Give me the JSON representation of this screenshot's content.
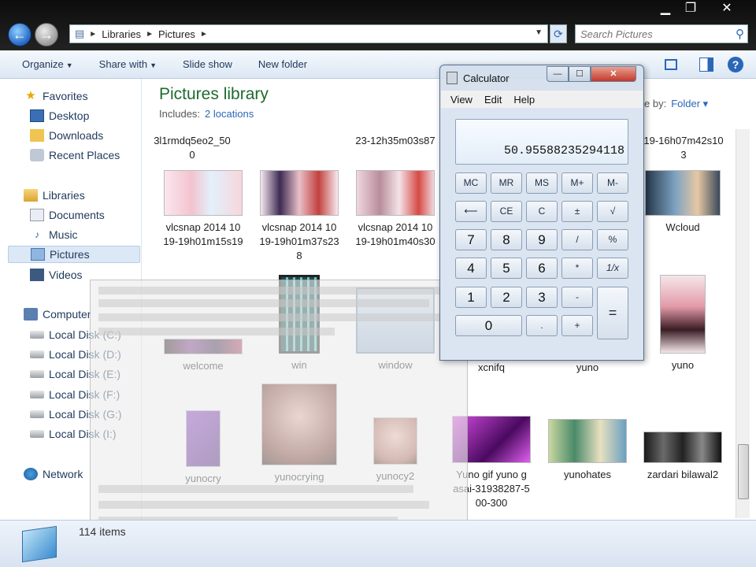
{
  "window": {
    "minimize": "▁",
    "maximize": "❐",
    "close": "✕"
  },
  "address": {
    "segments": [
      "Libraries",
      "Pictures"
    ]
  },
  "search": {
    "placeholder": "Search Pictures"
  },
  "toolbar": {
    "organize": "Organize",
    "share_with": "Share with",
    "slide_show": "Slide show",
    "new_folder": "New folder"
  },
  "sidebar": {
    "favorites": "Favorites",
    "desktop": "Desktop",
    "downloads": "Downloads",
    "recent_places": "Recent Places",
    "libraries": "Libraries",
    "documents": "Documents",
    "music": "Music",
    "pictures": "Pictures",
    "videos": "Videos",
    "computer": "Computer",
    "disks": [
      "Local Disk (C:)",
      "Local Disk (D:)",
      "Local Disk (E:)",
      "Local Disk (F:)",
      "Local Disk (G:)",
      "Local Disk (I:)"
    ],
    "network": "Network"
  },
  "library": {
    "title": "Pictures library",
    "includes_label": "Includes:",
    "locations_link": "2 locations",
    "arrange_label": "e by:",
    "arrange_value": "Folder ▾"
  },
  "top_captions": {
    "c1_line1": "3l1rmdq5eo2_50",
    "c1_line2": "0",
    "c2": "23-12h35m03s87",
    "c3_line1": "19-16h07m42s10",
    "c3_line2": "3"
  },
  "tiles": [
    {
      "name": "vlcsnap-2014-10-19-19h01m15s19",
      "l1": "vlcsnap 2014 10",
      "l2": "19-19h01m15s19",
      "l3": ""
    },
    {
      "name": "vlcsnap-2014-10-19-19h01m37s238",
      "l1": "vlcsnap 2014 10",
      "l2": "19-19h01m37s23",
      "l3": "8"
    },
    {
      "name": "vlcsnap-2014-10-19-19h01m40s30",
      "l1": "vlcsnap 2014 10",
      "l2": "19-19h01m40s30",
      "l3": ""
    },
    {
      "name": "Wcloud",
      "l1": "Wcloud"
    },
    {
      "name": "welcome",
      "l1": "welcome"
    },
    {
      "name": "win",
      "l1": "win"
    },
    {
      "name": "window",
      "l1": "window"
    },
    {
      "name": "xcnifq",
      "l1": "xcnifq"
    },
    {
      "name": "yuno-a",
      "l1": "yuno"
    },
    {
      "name": "yuno-b",
      "l1": "yuno"
    },
    {
      "name": "yunocry",
      "l1": "yunocry"
    },
    {
      "name": "yunocrying",
      "l1": "yunocrying"
    },
    {
      "name": "yunocy2",
      "l1": "yunocy2"
    },
    {
      "name": "yuno-gif",
      "l1": "Yuno gif yuno g",
      "l2": "asai-31938287-5",
      "l3": "00-300"
    },
    {
      "name": "yunohates",
      "l1": "yunohates"
    },
    {
      "name": "zardari-bilawal2",
      "l1": "zardari bilawal2"
    }
  ],
  "status": {
    "items": "114 items"
  },
  "calculator": {
    "title": "Calculator",
    "menu": [
      "View",
      "Edit",
      "Help"
    ],
    "display": "50.95588235294118",
    "keys": {
      "mc": "MC",
      "mr": "MR",
      "ms": "MS",
      "mplus": "M+",
      "mminus": "M-",
      "back": "⟵",
      "ce": "CE",
      "c": "C",
      "pm": "±",
      "sqrt": "√",
      "k7": "7",
      "k8": "8",
      "k9": "9",
      "div": "/",
      "pct": "%",
      "k4": "4",
      "k5": "5",
      "k6": "6",
      "mul": "*",
      "recip": "1/x",
      "k1": "1",
      "k2": "2",
      "k3": "3",
      "sub": "-",
      "eq": "=",
      "k0": "0",
      "dot": ".",
      "add": "+"
    }
  }
}
